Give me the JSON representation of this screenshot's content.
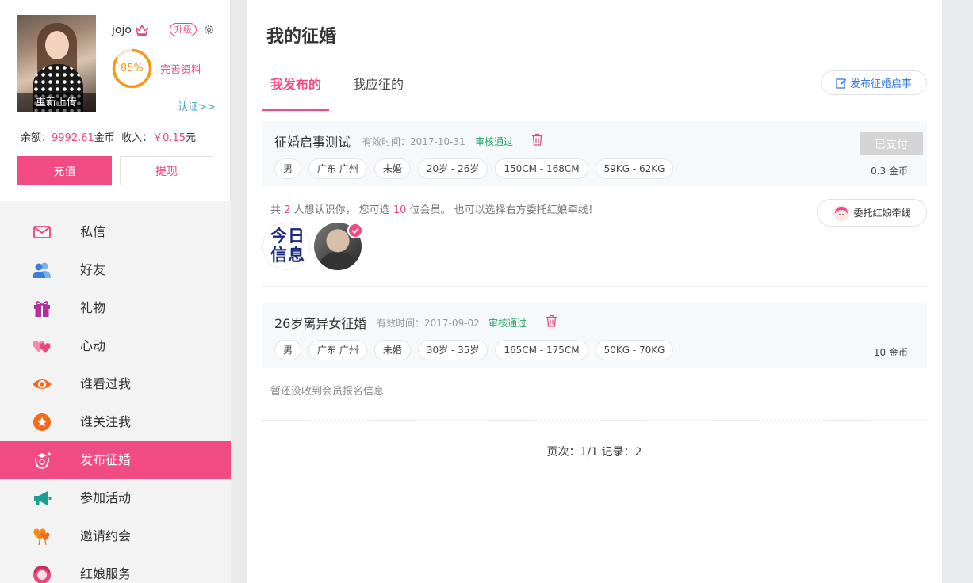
{
  "profile": {
    "reupload_label": "重新上传",
    "username": "jojo",
    "upgrade_label": "升级",
    "completion_percent": 85,
    "completion_text": "85%",
    "complete_profile_label": "完善资料",
    "verify_label": "认证>>",
    "balance_label": "余额：",
    "balance_value": "9992.61",
    "balance_unit": "金币",
    "income_label": "收入：",
    "income_value": "￥0.15",
    "income_unit": "元",
    "recharge_label": "充值",
    "withdraw_label": "提现"
  },
  "nav": {
    "items": [
      {
        "label": "私信",
        "icon": "mail-icon"
      },
      {
        "label": "好友",
        "icon": "friends-icon"
      },
      {
        "label": "礼物",
        "icon": "gift-icon"
      },
      {
        "label": "心动",
        "icon": "hearts-icon"
      },
      {
        "label": "谁看过我",
        "icon": "eye-icon"
      },
      {
        "label": "谁关注我",
        "icon": "star-icon"
      },
      {
        "label": "发布征婚",
        "icon": "publish-icon",
        "active": true
      },
      {
        "label": "参加活动",
        "icon": "megaphone-icon"
      },
      {
        "label": "邀请约会",
        "icon": "balloon-heart-icon"
      },
      {
        "label": "红娘服务",
        "icon": "matchmaker-icon"
      }
    ]
  },
  "main": {
    "title": "我的征婚",
    "tabs": [
      {
        "label": "我发布的",
        "active": true
      },
      {
        "label": "我应征的",
        "active": false
      }
    ],
    "publish_button": "发布征婚启事",
    "posts": [
      {
        "title": "征婚启事测试",
        "date": "有效时间：2017-10-31",
        "status": "审核通过",
        "tags": [
          "男",
          "广东 广州",
          "未婚",
          "20岁 - 26岁",
          "150CM - 168CM",
          "59KG - 62KG"
        ],
        "paid_label": "已支付",
        "coins": "0.3 金币"
      },
      {
        "title": "26岁离异女征婚",
        "date": "有效时间：2017-09-02",
        "status": "审核通过",
        "tags": [
          "男",
          "广东 广州",
          "未婚",
          "30岁 - 35岁",
          "165CM - 175CM",
          "50KG - 70KG"
        ],
        "coins": "10 金币"
      }
    ],
    "interest": {
      "prefix": "共 ",
      "count": "2",
      "mid": " 人想认识你， 您可选 ",
      "selectable": "10",
      "suffix": " 位会员。 也可以选择右方委托红娘牵线！"
    },
    "member_logo_text": "今日信息",
    "matchmaker_button": "委托红娘牵线",
    "no_signup_text": "暂还没收到会员报名信息",
    "pager_text": "页次：1/1  记录：2"
  },
  "colors": {
    "accent": "#f04b82",
    "progress": "#f39a1e",
    "status_ok": "#2aa36a",
    "link_blue": "#3a7bd5"
  }
}
